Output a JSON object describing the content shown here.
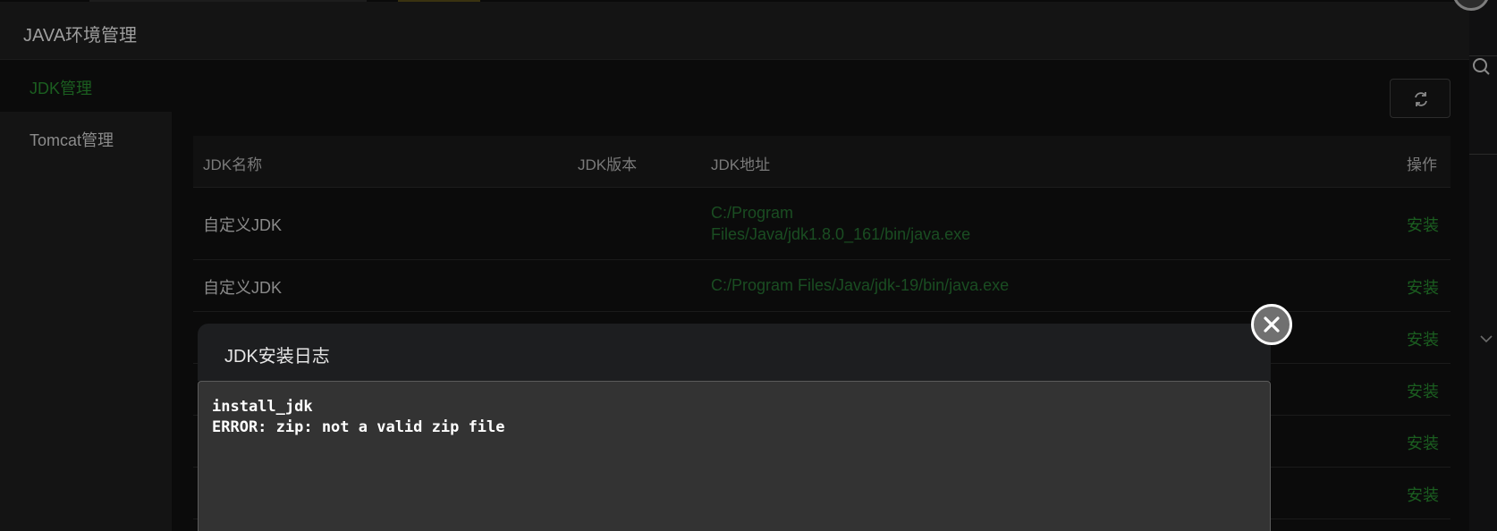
{
  "window": {
    "title": "JAVA环境管理"
  },
  "sidebar": {
    "items": [
      {
        "label": "JDK管理",
        "active": true
      },
      {
        "label": "Tomcat管理",
        "active": false
      }
    ]
  },
  "toolbar": {
    "refresh_icon": "refresh-icon"
  },
  "table": {
    "headers": {
      "name": "JDK名称",
      "version": "JDK版本",
      "path": "JDK地址",
      "ops": "操作"
    },
    "rows": [
      {
        "name": "自定义JDK",
        "version": "",
        "path": "C:/Program Files/Java/jdk1.8.0_161/bin/java.exe",
        "op": "安装"
      },
      {
        "name": "自定义JDK",
        "version": "",
        "path": "C:/Program Files/Java/jdk-19/bin/java.exe",
        "op": "安装"
      },
      {
        "name": "",
        "version": "",
        "path": "",
        "op": "安装"
      },
      {
        "name": "",
        "version": "",
        "path": "",
        "op": "安装"
      },
      {
        "name": "",
        "version": "",
        "path": "",
        "op": "安装"
      },
      {
        "name": "",
        "version": "",
        "path": "",
        "op": "安装"
      }
    ]
  },
  "log_modal": {
    "title": "JDK安装日志",
    "lines": [
      "install_jdk",
      "ERROR: zip: not a valid zip file"
    ]
  },
  "colors": {
    "accent_green": "#1b5e20",
    "background": "#0b0b0b",
    "log_background": "#333333"
  }
}
